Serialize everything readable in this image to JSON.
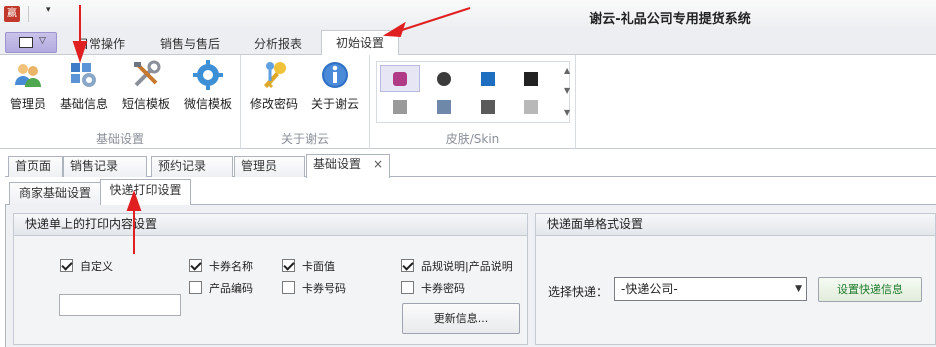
{
  "window": {
    "title": "谢云-礼品公司专用提货系统"
  },
  "quick_access": {
    "customize": "▾"
  },
  "ribbon": {
    "tabs": [
      {
        "label": "日常操作"
      },
      {
        "label": "销售与售后"
      },
      {
        "label": "分析报表"
      },
      {
        "label": "初始设置"
      }
    ],
    "groups": {
      "basic": {
        "label": "基础设置",
        "buttons": [
          {
            "label": "管理员",
            "icon": "users-icon"
          },
          {
            "label": "基础信息",
            "icon": "settings-grid-icon"
          },
          {
            "label": "短信模板",
            "icon": "tools-icon"
          },
          {
            "label": "微信模板",
            "icon": "gear-icon"
          }
        ]
      },
      "about": {
        "label": "关于谢云",
        "buttons": [
          {
            "label": "修改密码",
            "icon": "keys-icon"
          },
          {
            "label": "关于谢云",
            "icon": "info-icon"
          }
        ]
      },
      "skin": {
        "label": "皮肤/Skin"
      }
    }
  },
  "doc_tabs": [
    {
      "label": "首页面"
    },
    {
      "label": "销售记录"
    },
    {
      "label": "预约记录"
    },
    {
      "label": "管理员"
    },
    {
      "label": "基础设置",
      "close": "×"
    }
  ],
  "sub_tabs": [
    {
      "label": "商家基础设置"
    },
    {
      "label": "快递打印设置"
    }
  ],
  "print_content": {
    "title": "快递单上的打印内容设置",
    "options": [
      {
        "label": "自定义",
        "checked": true
      },
      {
        "label": "卡券名称",
        "checked": true
      },
      {
        "label": "卡面值",
        "checked": true
      },
      {
        "label": "品规说明|产品说明",
        "checked": true
      },
      {
        "label": "产品编码",
        "checked": false
      },
      {
        "label": "卡券号码",
        "checked": false
      },
      {
        "label": "卡券密码",
        "checked": false
      }
    ],
    "custom_value": "",
    "update_button": "更新信息..."
  },
  "format": {
    "title": "快递面单格式设置",
    "select_label": "选择快递：",
    "select_value": "-快递公司-",
    "set_button": "设置快递信息"
  },
  "colors": {
    "accent_arrow": "#e02020",
    "app_menu": "#b8b1e2",
    "green_text": "#1d7a2b"
  }
}
